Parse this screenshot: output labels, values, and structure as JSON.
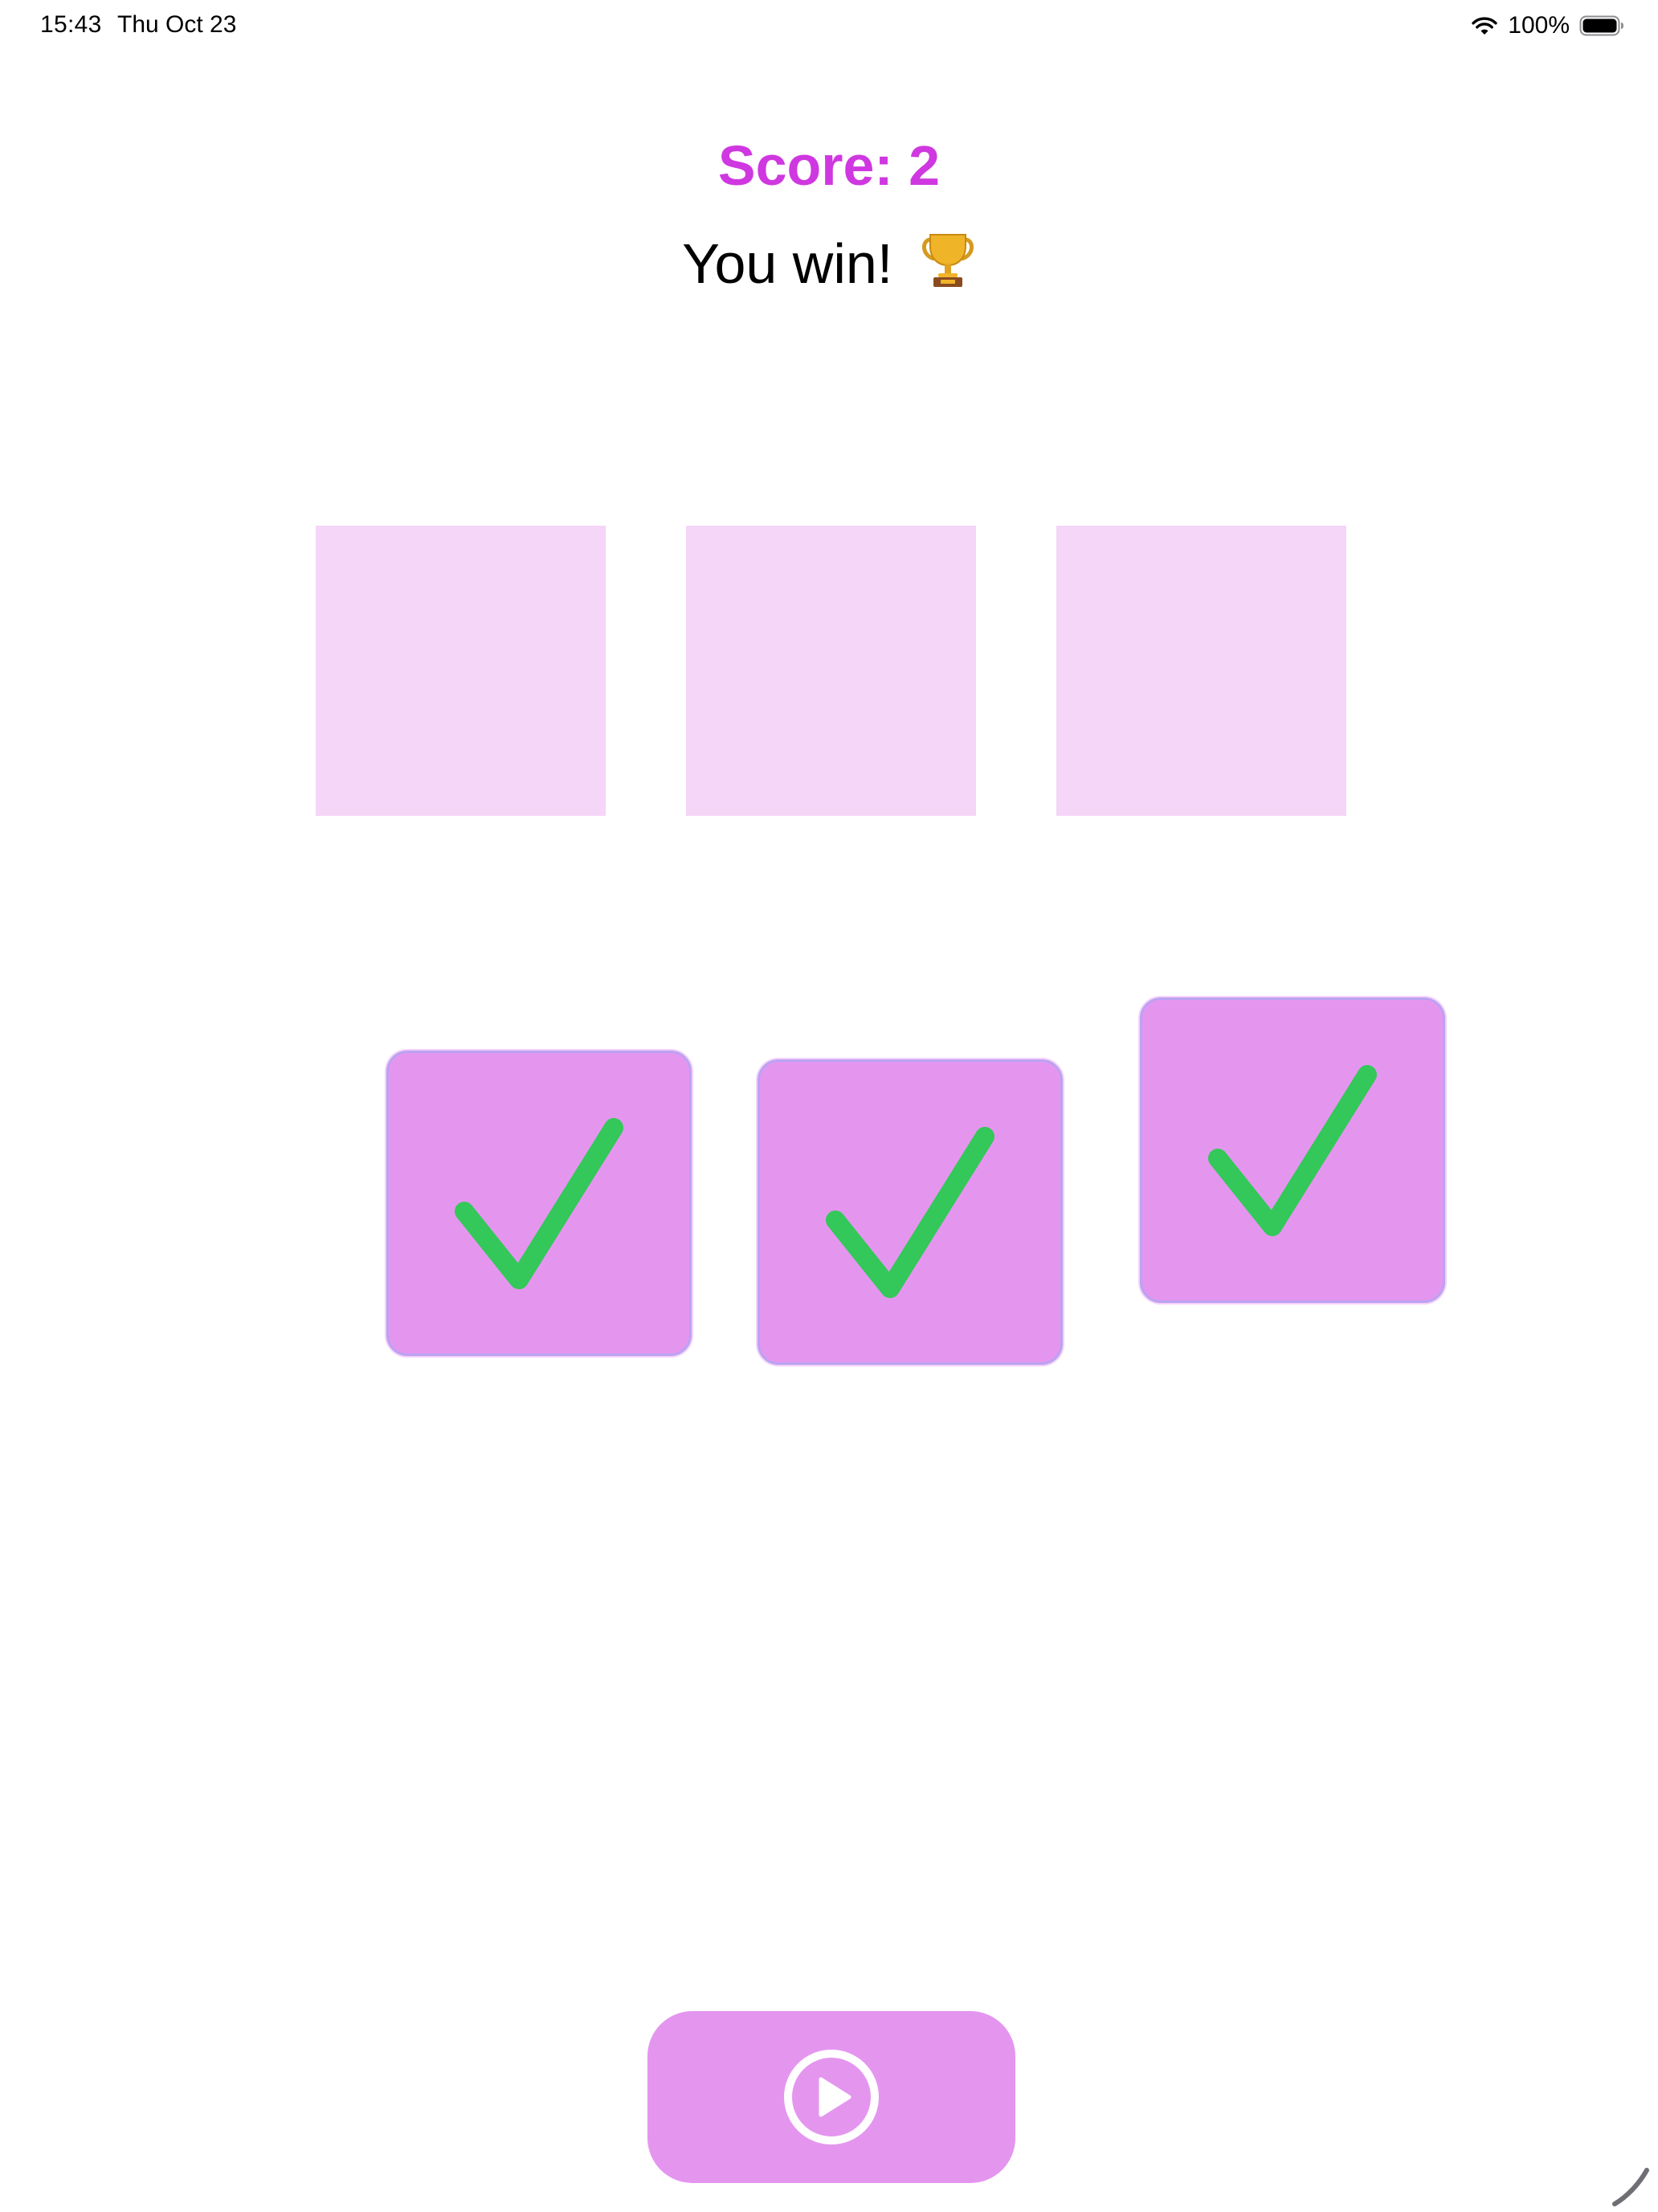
{
  "status_bar": {
    "time": "15:43",
    "date": "Thu Oct 23",
    "battery": "100%",
    "icons": [
      "wifi-icon",
      "battery-icon"
    ]
  },
  "game": {
    "score_text": "Score: 2",
    "result_text": "You win!",
    "result_icon": "trophy-icon",
    "slots": [
      {
        "state": "empty"
      },
      {
        "state": "empty"
      },
      {
        "state": "empty"
      }
    ],
    "cards": [
      {
        "icon": "check-icon",
        "state": "correct"
      },
      {
        "icon": "check-icon",
        "state": "correct"
      },
      {
        "icon": "check-icon",
        "state": "correct"
      }
    ]
  },
  "controls": {
    "play_icon": "play-icon"
  },
  "colors": {
    "accent": "#cf38e0",
    "card": "#e496ef",
    "slot": "#f5d5f8",
    "check": "#34c759",
    "button": "#e496ef"
  }
}
